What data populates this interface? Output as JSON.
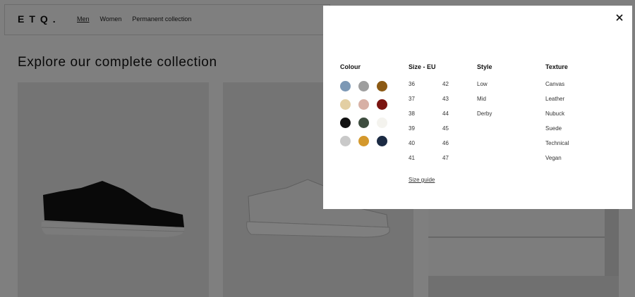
{
  "brand": {
    "logo": "ETQ."
  },
  "nav": {
    "items": [
      "Men",
      "Women",
      "Permanent collection"
    ],
    "active": "Men"
  },
  "page": {
    "headline": "Explore our complete collection"
  },
  "filters": {
    "close_icon": "close-icon",
    "colour": {
      "title": "Colour",
      "swatches": [
        "#7c98b5",
        "#9e9e9e",
        "#8c5a14",
        "#e3cfa3",
        "#d7b0a5",
        "#7a1410",
        "#111111",
        "#3e4d3f",
        "#f4f3ee",
        "#c9c9c9",
        "#d4982c",
        "#1b2a43"
      ]
    },
    "size": {
      "title": "Size - EU",
      "values": [
        "36",
        "42",
        "37",
        "43",
        "38",
        "44",
        "39",
        "45",
        "40",
        "46",
        "41",
        "47"
      ],
      "guide_label": "Size guide"
    },
    "style": {
      "title": "Style",
      "items": [
        "Low",
        "Mid",
        "Derby"
      ]
    },
    "texture": {
      "title": "Texture",
      "items": [
        "Canvas",
        "Leather",
        "Nubuck",
        "Suede",
        "Technical",
        "Vegan"
      ]
    }
  }
}
